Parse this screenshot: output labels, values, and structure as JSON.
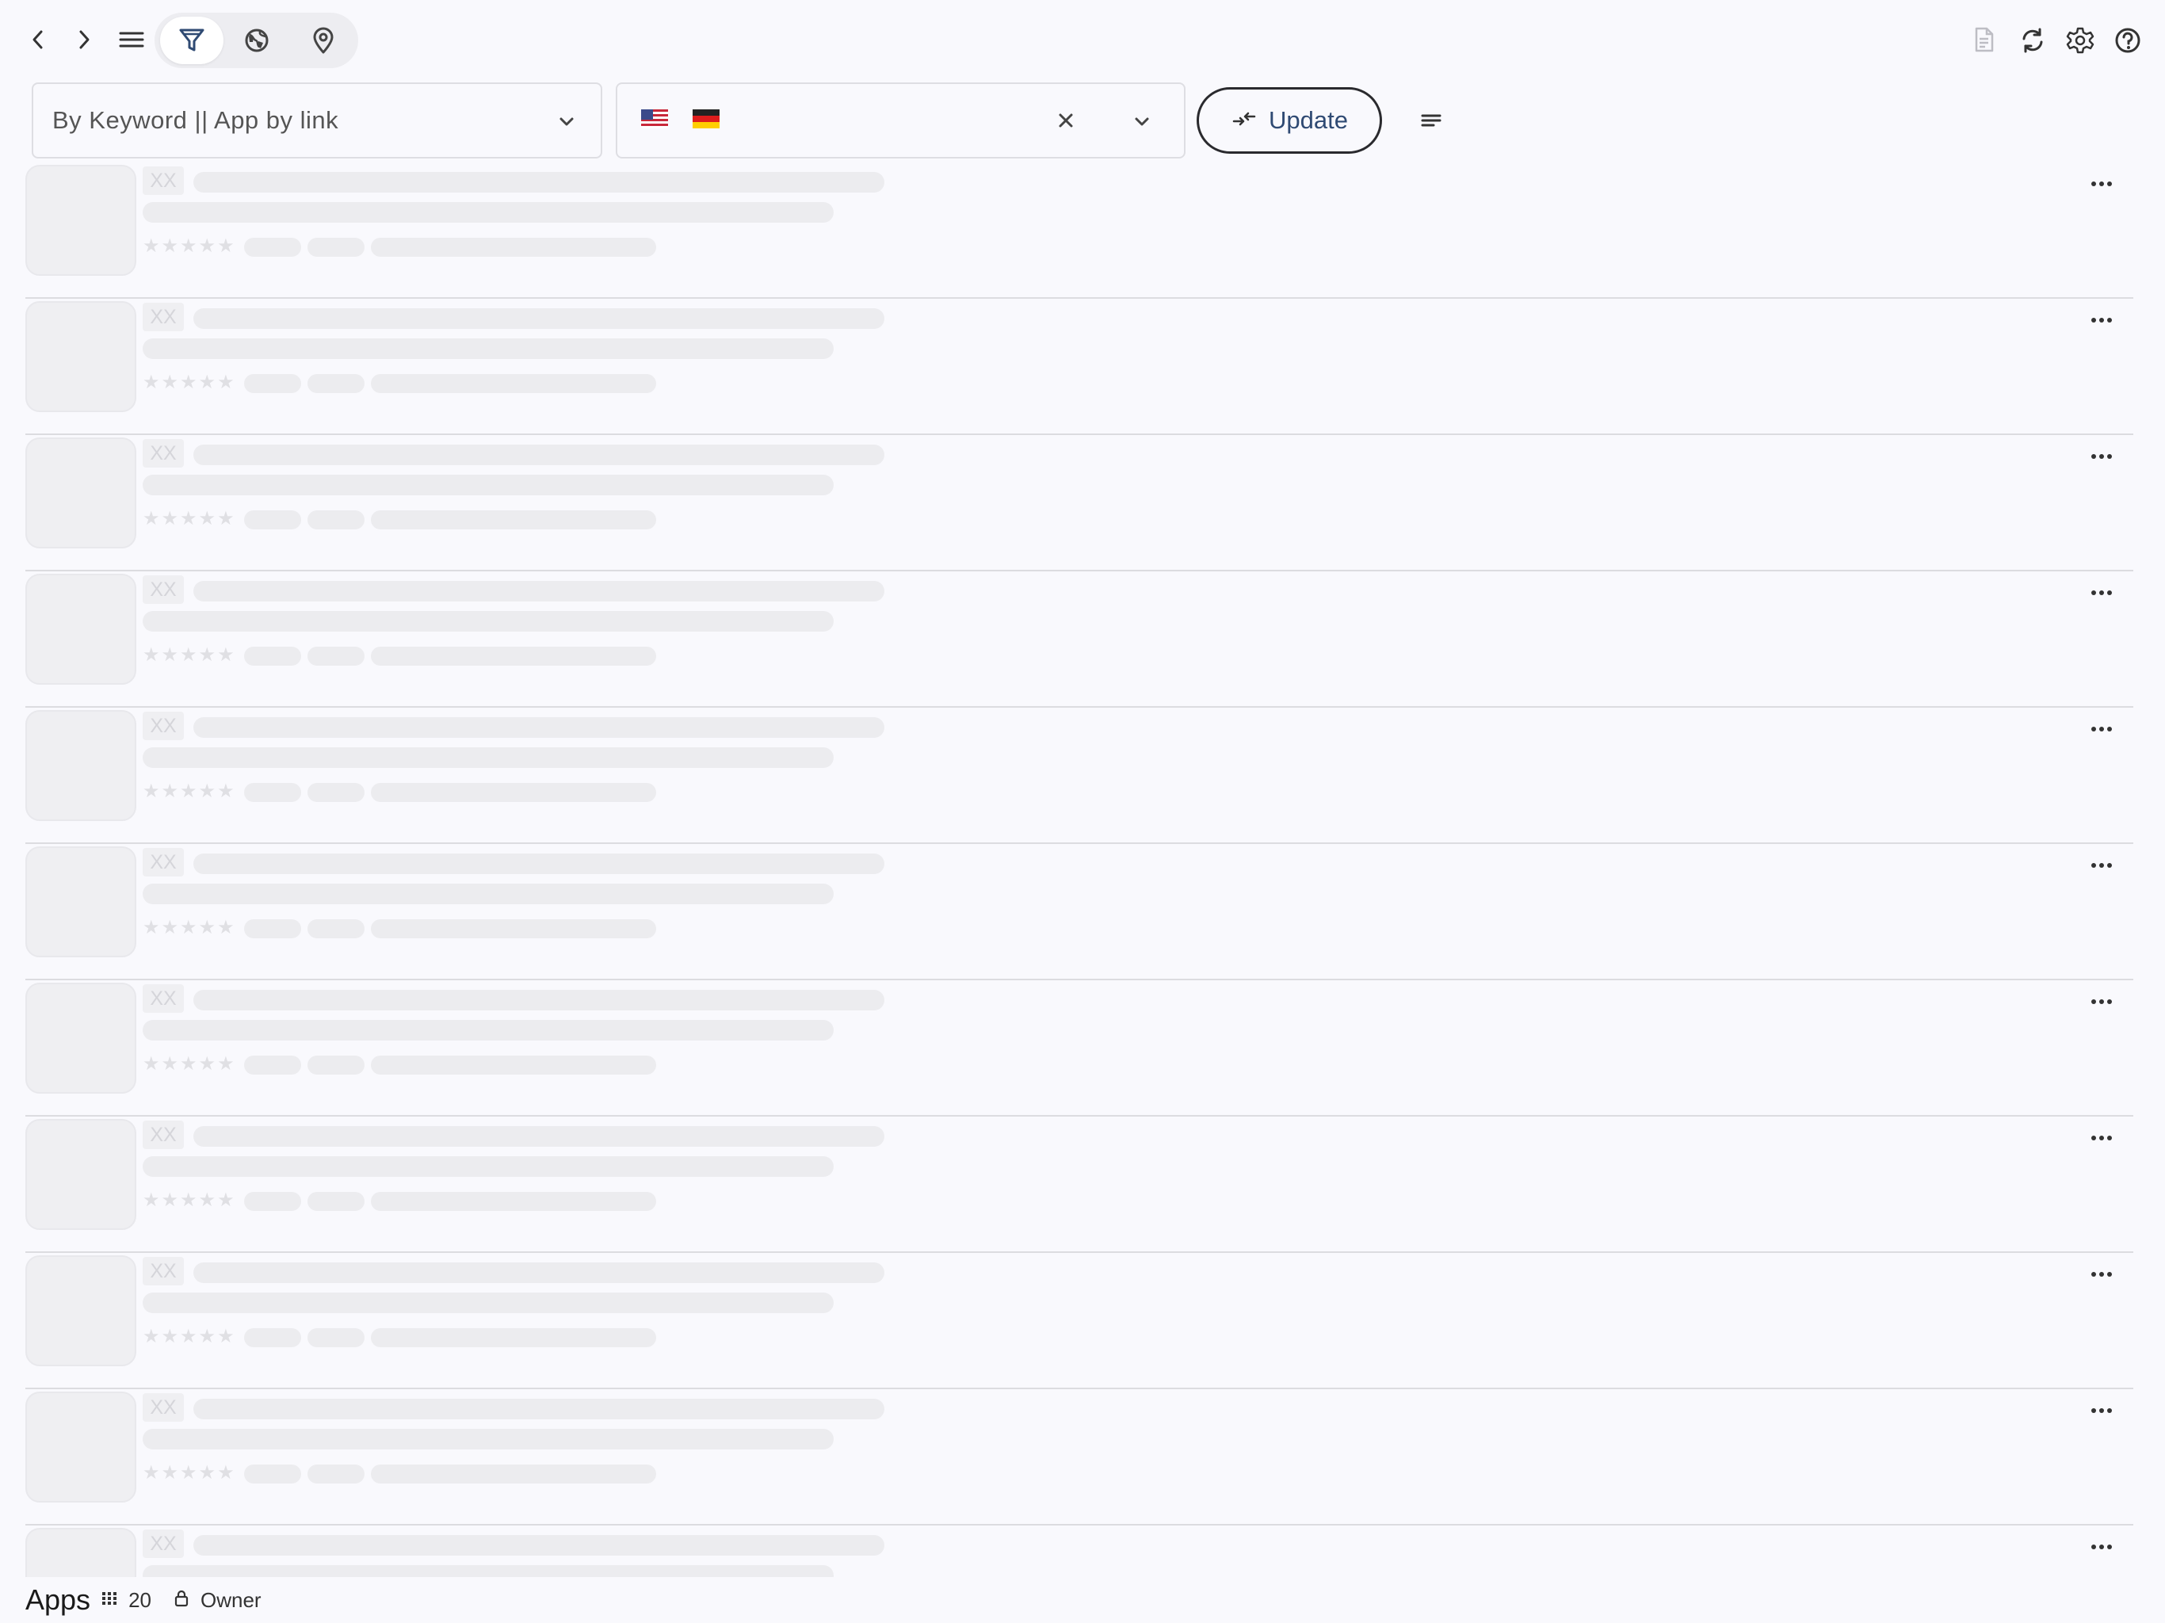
{
  "toolbar": {
    "icons": [
      "chevron-left-icon",
      "chevron-right-icon",
      "menu-icon",
      "filter-icon",
      "globe-icon",
      "location-pin-icon",
      "report-icon",
      "refresh-icon",
      "settings-icon",
      "help-icon"
    ]
  },
  "search": {
    "placeholder": "By Keyword || App by link"
  },
  "country": {
    "flags": [
      "US",
      "DE"
    ]
  },
  "update": {
    "label": "Update"
  },
  "list": {
    "rows": [
      {
        "placeholder_code": "XX"
      },
      {
        "placeholder_code": "XX"
      },
      {
        "placeholder_code": "XX"
      },
      {
        "placeholder_code": "XX"
      },
      {
        "placeholder_code": "XX"
      },
      {
        "placeholder_code": "XX"
      },
      {
        "placeholder_code": "XX"
      },
      {
        "placeholder_code": "XX"
      },
      {
        "placeholder_code": "XX"
      },
      {
        "placeholder_code": "XX"
      },
      {
        "placeholder_code": "XX"
      }
    ]
  },
  "footer": {
    "title": "Apps",
    "count": "20",
    "owner": "Owner"
  },
  "colors": {
    "background": "#f9f9fd",
    "skeleton": "#ececef",
    "accent_text": "#2f4a73"
  }
}
